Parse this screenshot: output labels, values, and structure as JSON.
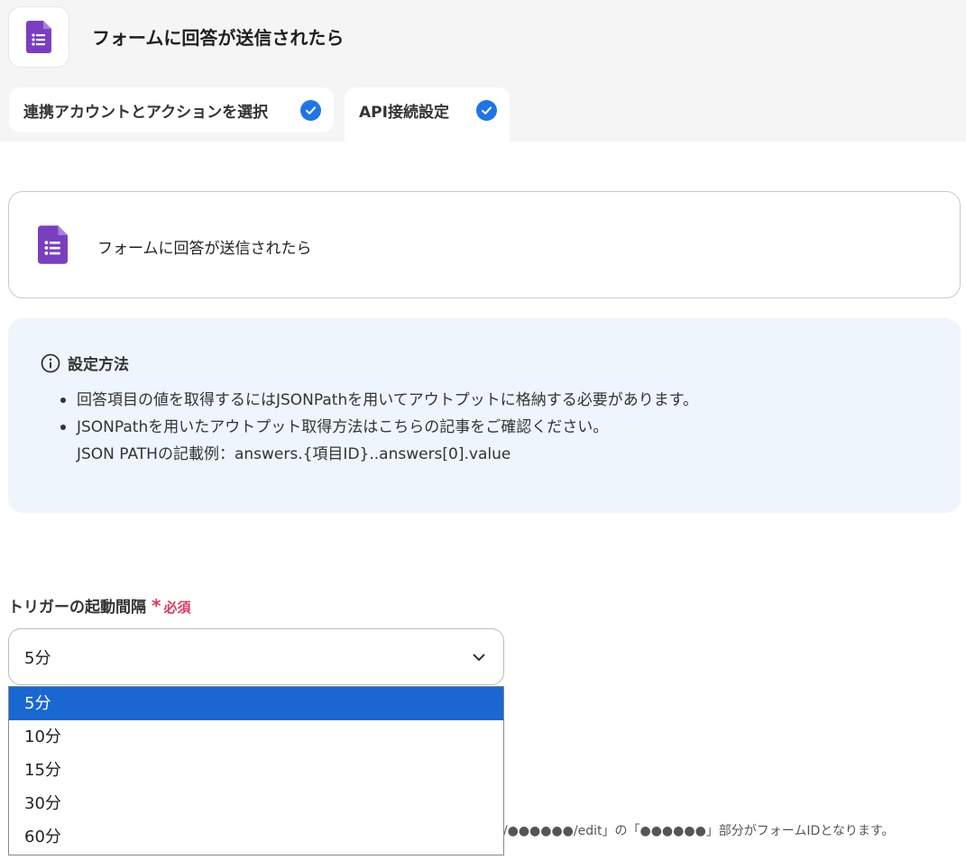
{
  "header": {
    "title": "フォームに回答が送信されたら",
    "app_icon": "google-forms-icon"
  },
  "tabs": [
    {
      "label": "連携アカウントとアクションを選択",
      "completed": true
    },
    {
      "label": "API接続設定",
      "completed": true
    }
  ],
  "app_card": {
    "title": "フォームに回答が送信されたら",
    "icon": "google-forms-icon"
  },
  "info": {
    "title": "設定方法",
    "items": [
      "回答項目の値を取得するにはJSONPathを用いてアウトプットに格納する必要があります。",
      "JSONPathを用いたアウトプット取得方法はこちらの記事をご確認ください。"
    ],
    "example": "JSON PATHの記載例：answers.{項目ID}..answers[0].value"
  },
  "trigger_interval": {
    "label": "トリガーの起動間隔",
    "required_mark": "*",
    "required_text": "必須",
    "selected": "5分",
    "options": [
      "5分",
      "10分",
      "15分",
      "30分",
      "60分"
    ]
  },
  "form_id_note": "d/●●●●●●/edit」の「●●●●●●」部分がフォームIDとなります。",
  "colors": {
    "accent": "#2075e6",
    "selected_option": "#1a67d2",
    "required": "#e0385b",
    "forms_purple": "#7a3fbf"
  }
}
